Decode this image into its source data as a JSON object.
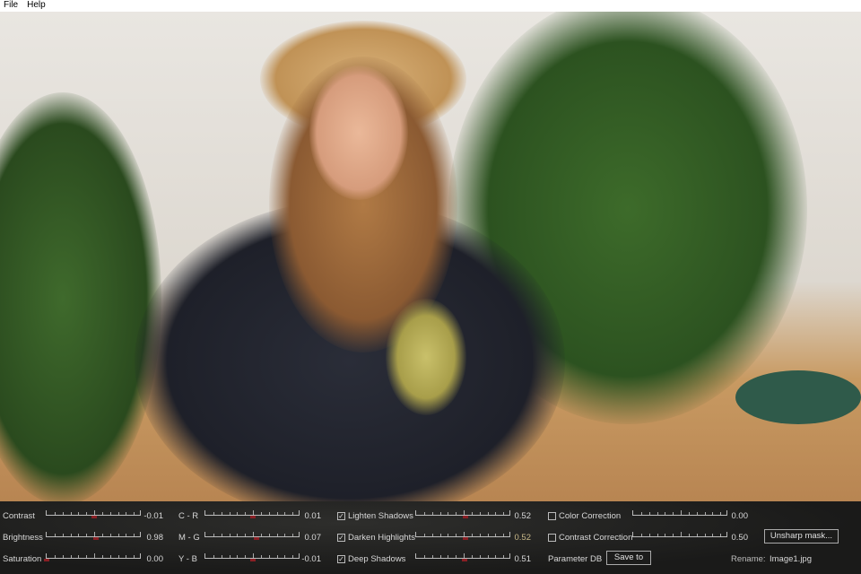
{
  "menu": {
    "items": [
      "File",
      "Help"
    ]
  },
  "panel": {
    "left_sliders": [
      {
        "label": "Contrast",
        "value": "-0.01",
        "pos": 0.5
      },
      {
        "label": "Brightness",
        "value": "0.98",
        "pos": 0.52
      },
      {
        "label": "Saturation",
        "value": "0.00",
        "pos": 0.0
      }
    ],
    "color_sliders": [
      {
        "label": "C - R",
        "value": "0.01",
        "pos": 0.5
      },
      {
        "label": "M - G",
        "value": "0.07",
        "pos": 0.54
      },
      {
        "label": "Y - B",
        "value": "-0.01",
        "pos": 0.5
      }
    ],
    "shadow_sliders": [
      {
        "label": "Lighten Shadows",
        "checked": true,
        "value": "0.52",
        "pos": 0.52
      },
      {
        "label": "Darken Highlights",
        "checked": true,
        "value": "0.52",
        "pos": 0.52
      },
      {
        "label": "Deep Shadows",
        "checked": true,
        "value": "0.51",
        "pos": 0.51
      }
    ],
    "correction": [
      {
        "label": "Color Correction",
        "checked": false,
        "value": "0.00"
      },
      {
        "label": "Contrast Correction",
        "checked": false,
        "value": "0.50"
      }
    ],
    "unsharp_label": "Unsharp mask...",
    "param_db_label": "Parameter DB",
    "save_label": "Save to",
    "rename_label": "Rename:",
    "rename_value": "Image1.jpg"
  }
}
